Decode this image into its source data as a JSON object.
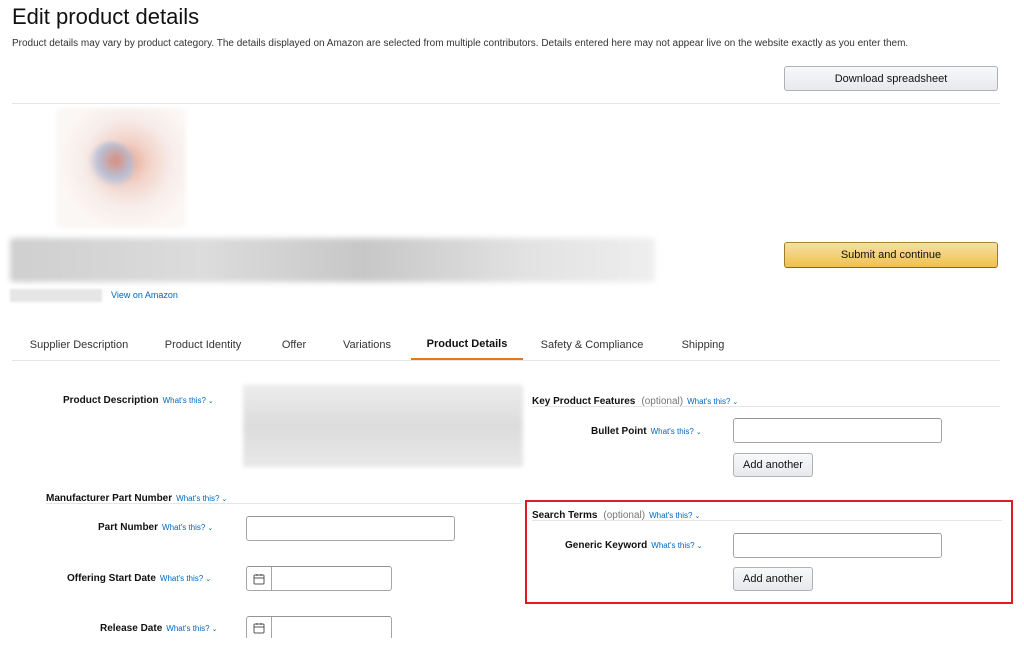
{
  "header": {
    "title": "Edit product details",
    "subtitle": "Product details may vary by product category. The details displayed on Amazon are selected from multiple contributors. Details entered here may not appear live on the website exactly as you enter them.",
    "download_label": "Download spreadsheet"
  },
  "product": {
    "submit_label": "Submit and continue",
    "view_link": "View on Amazon"
  },
  "tabs": [
    {
      "label": "Supplier Description",
      "active": false
    },
    {
      "label": "Product Identity",
      "active": false
    },
    {
      "label": "Offer",
      "active": false
    },
    {
      "label": "Variations",
      "active": false
    },
    {
      "label": "Product Details",
      "active": true
    },
    {
      "label": "Safety & Compliance",
      "active": false
    },
    {
      "label": "Shipping",
      "active": false
    }
  ],
  "whats_this": "What's this?",
  "optional_text": "(optional)",
  "left_form": {
    "product_description": {
      "label": "Product Description"
    },
    "manufacturer_part_number": {
      "label": "Manufacturer Part Number"
    },
    "part_number": {
      "label": "Part Number",
      "value": ""
    },
    "offering_start_date": {
      "label": "Offering Start Date",
      "value": ""
    },
    "release_date": {
      "label": "Release Date",
      "value": ""
    }
  },
  "right_form": {
    "key_product_features": {
      "label": "Key Product Features"
    },
    "bullet_point": {
      "label": "Bullet Point",
      "value": "",
      "add_label": "Add another"
    },
    "search_terms": {
      "label": "Search Terms"
    },
    "generic_keyword": {
      "label": "Generic Keyword",
      "value": "",
      "add_label": "Add another"
    }
  },
  "colors": {
    "accent_tab": "#e47911",
    "highlight_border": "#e01b24",
    "link": "#0066c0",
    "primary_button": "#f0c14b"
  },
  "icons": [
    "chevron-down-icon",
    "calendar-icon"
  ]
}
